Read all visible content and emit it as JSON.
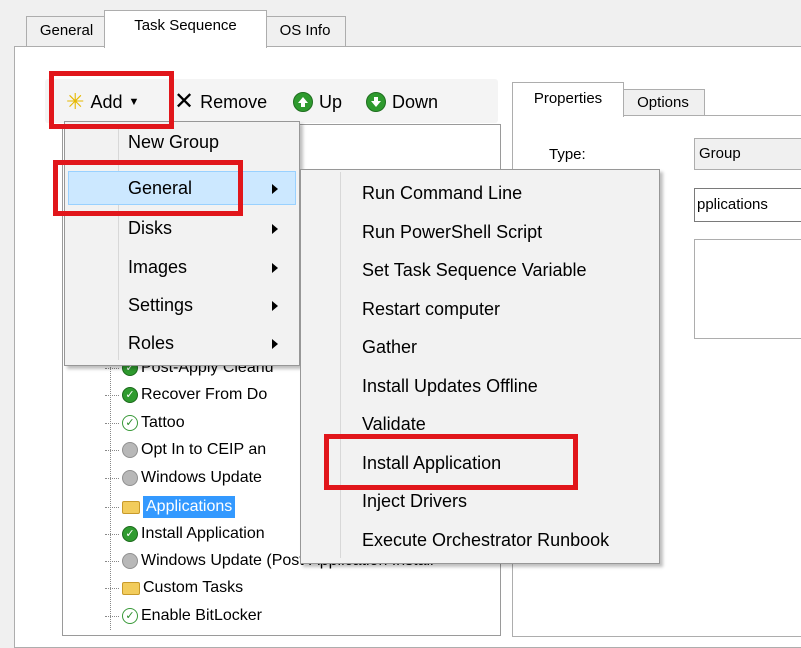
{
  "tabs": [
    "General",
    "Task Sequence",
    "OS Info"
  ],
  "toolbar": {
    "add_label": "Add",
    "remove_label": "Remove",
    "up_label": "Up",
    "down_label": "Down"
  },
  "tree": {
    "items": [
      {
        "label": "Post-Apply Cleanu",
        "icon": "green-sequence-icon"
      },
      {
        "label": "Recover From Do",
        "icon": "green-sequence-icon"
      },
      {
        "label": "Tattoo",
        "icon": "check-icon"
      },
      {
        "label": "Opt In to CEIP an",
        "icon": "disabled-step-icon"
      },
      {
        "label": "Windows Update",
        "icon": "disabled-step-icon"
      },
      {
        "label": "Applications",
        "icon": "folder-icon",
        "selected": true
      },
      {
        "label": "Install Application",
        "icon": "green-sequence-icon"
      },
      {
        "label": "Windows Update (Post-Application Install",
        "icon": "disabled-step-icon"
      },
      {
        "label": "Custom Tasks",
        "icon": "folder-icon"
      },
      {
        "label": "Enable BitLocker",
        "icon": "check-icon"
      }
    ]
  },
  "properties": {
    "tabs": [
      "Properties",
      "Options"
    ],
    "type_label": "Type:",
    "type_value": "Group",
    "name_value": "pplications"
  },
  "add_menu": {
    "items": [
      "New Group",
      "General",
      "Disks",
      "Images",
      "Settings",
      "Roles"
    ]
  },
  "general_submenu": {
    "items": [
      "Run Command Line",
      "Run PowerShell Script",
      "Set Task Sequence Variable",
      "Restart computer",
      "Gather",
      "Install Updates Offline",
      "Validate",
      "Install Application",
      "Inject Drivers",
      "Execute Orchestrator Runbook"
    ]
  },
  "colors": {
    "highlight_box": "#e1161b",
    "selection": "#3399ff",
    "menu_hover": "#cce8ff"
  }
}
